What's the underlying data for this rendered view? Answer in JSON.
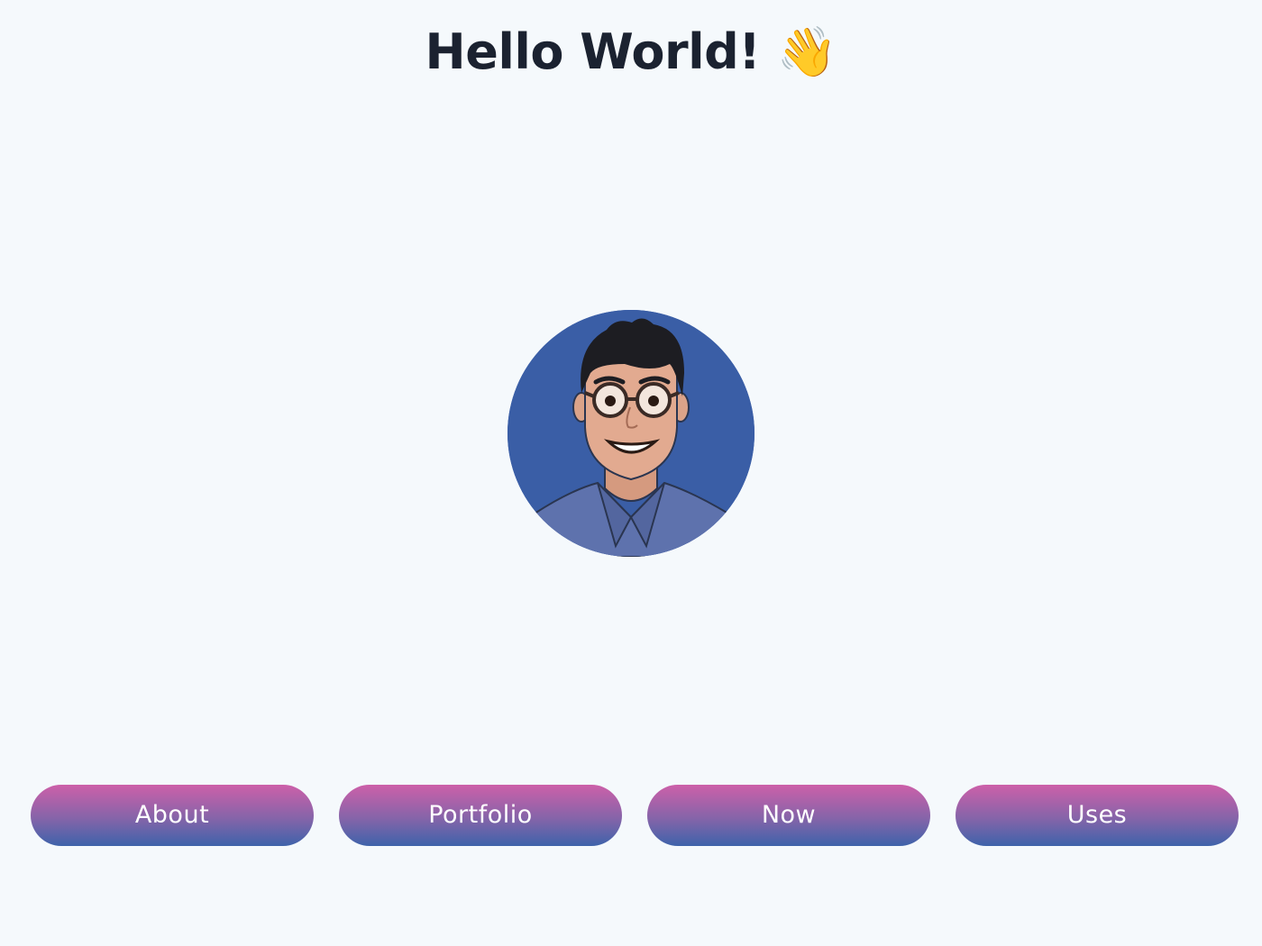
{
  "header": {
    "title": "Hello World! 👋"
  },
  "avatar": {
    "icon": "avatar-illustration",
    "background_color": "#3a5ea6"
  },
  "nav": {
    "items": [
      {
        "label": "About"
      },
      {
        "label": "Portfolio"
      },
      {
        "label": "Now"
      },
      {
        "label": "Uses"
      }
    ],
    "gradient_top": "#cd60a9",
    "gradient_bottom": "#3e63aa"
  },
  "colors": {
    "page_background": "#f5f9fc",
    "title_text": "#1b2230"
  }
}
